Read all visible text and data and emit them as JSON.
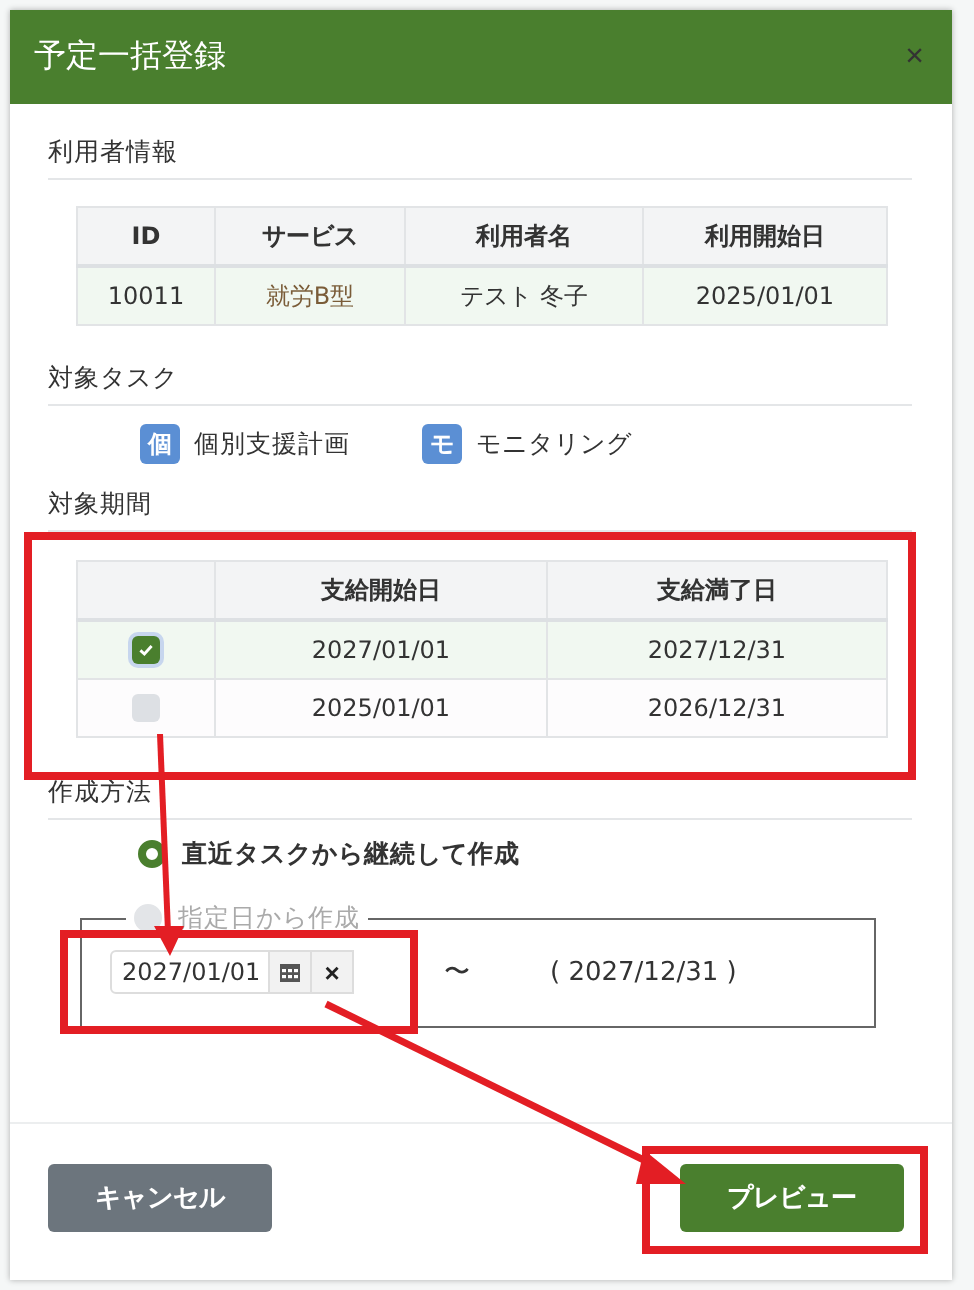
{
  "dialog": {
    "title": "予定一括登録",
    "close": "×"
  },
  "user_info": {
    "heading": "利用者情報",
    "columns": [
      "ID",
      "サービス",
      "利用者名",
      "利用開始日"
    ],
    "rows": [
      [
        "10011",
        "就労B型",
        "テスト 冬子",
        "2025/01/01"
      ]
    ]
  },
  "tasks": {
    "heading": "対象タスク",
    "items": [
      {
        "badge": "個",
        "label": "個別支援計画"
      },
      {
        "badge": "モ",
        "label": "モニタリング"
      }
    ]
  },
  "period": {
    "heading": "対象期間",
    "columns": [
      "支給開始日",
      "支給満了日"
    ],
    "rows": [
      {
        "checked": true,
        "start": "2027/01/01",
        "end": "2027/12/31"
      },
      {
        "checked": false,
        "start": "2025/01/01",
        "end": "2026/12/31"
      }
    ]
  },
  "method": {
    "heading": "作成方法",
    "options": [
      {
        "label": "直近タスクから継続して作成",
        "selected": true,
        "disabled": false
      },
      {
        "label": "指定日から作成",
        "selected": false,
        "disabled": true
      }
    ],
    "date_from": "2027/01/01",
    "clear": "×",
    "separator": "〜",
    "date_to": "( 2027/12/31 )"
  },
  "buttons": {
    "cancel": "キャンセル",
    "preview": "プレビュー"
  }
}
